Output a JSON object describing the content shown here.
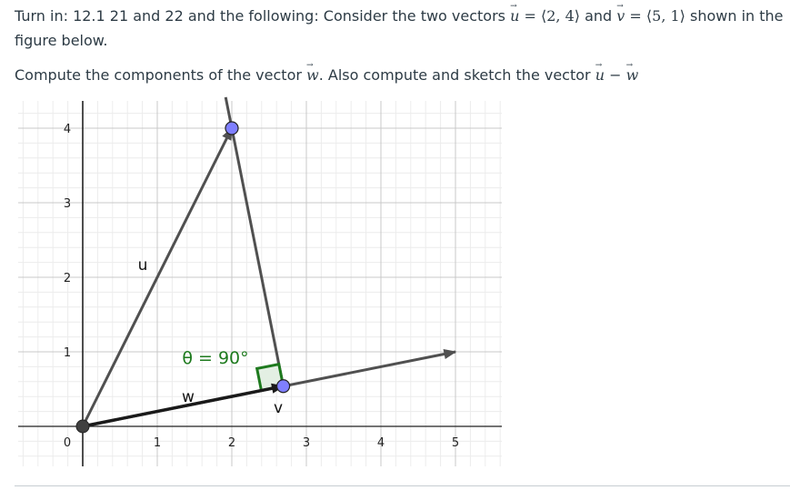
{
  "instructions": {
    "line1_prefix": "Turn in: 12.1 21 and 22 and the following: Consider the two vectors ",
    "u_name": "u",
    "u_value": " = ⟨2, 4⟩",
    "and": " and ",
    "v_name": "v",
    "v_value": " = ⟨5, 1⟩",
    "line1_suffix": " shown in the figure below.",
    "line2_prefix": "Compute the components of the vector ",
    "w_name": "w",
    "line2_middle": ". Also compute and sketch the vector ",
    "minus": " − ",
    "u_name2": "u",
    "w_name2": "w"
  },
  "figure": {
    "x_ticks": [
      "0",
      "1",
      "2",
      "3",
      "4",
      "5"
    ],
    "y_ticks": [
      "1",
      "2",
      "3",
      "4"
    ],
    "vector_u": {
      "label": "u",
      "components": [
        2,
        4
      ]
    },
    "vector_v": {
      "label": "v",
      "components": [
        5,
        1
      ]
    },
    "vector_w": {
      "label": "w",
      "components": [
        2.69,
        0.54
      ]
    },
    "angle_label": "θ = 90°",
    "colors": {
      "vector": "#505050",
      "w_vector": "#1a1a1a",
      "point": "#7f7fff",
      "origin_point": "#404040",
      "angle": "#1e7a1e",
      "angle_fill": "#e3efe3",
      "grid_major": "#c8c8c8",
      "grid_minor": "#ececec"
    }
  }
}
